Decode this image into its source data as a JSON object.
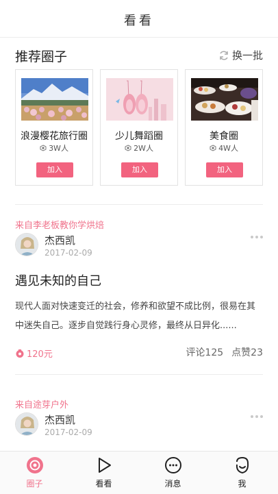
{
  "header": {
    "title": "看看"
  },
  "recommended": {
    "title": "推荐圈子",
    "refresh_label": "换一批",
    "join_label": "加入",
    "circles": [
      {
        "name": "浪漫樱花旅行圈",
        "members": "3W人",
        "image": "mountain-blossom-photo"
      },
      {
        "name": "少儿舞蹈圈",
        "members": "2W人",
        "image": "ballet-shoes-photo"
      },
      {
        "name": "美食圈",
        "members": "4W人",
        "image": "dessert-table-photo"
      }
    ]
  },
  "posts": [
    {
      "source": "来自李老板教你学烘焙",
      "author": "杰西凯",
      "date": "2017-02-09",
      "title": "遇见未知的自己",
      "excerpt": "现代人面对快速变迁的社会，修养和欲望不成比例，很易在其中迷失自己。逐步自觉践行身心灵修，最终从日异化......",
      "price": "120元",
      "comments": "评论125",
      "likes": "点赞23"
    },
    {
      "source": "来自途芽户外",
      "author": "杰西凯",
      "date": "2017-02-09"
    }
  ],
  "tabbar": {
    "tabs": [
      {
        "label": "圈子",
        "icon": "circle-icon",
        "active": true
      },
      {
        "label": "看看",
        "icon": "play-icon",
        "active": false
      },
      {
        "label": "消息",
        "icon": "message-icon",
        "active": false
      },
      {
        "label": "我",
        "icon": "profile-icon",
        "active": false
      }
    ]
  },
  "colors": {
    "accent": "#f2637f",
    "source_text": "#f0738c",
    "divider": "#ececec"
  }
}
